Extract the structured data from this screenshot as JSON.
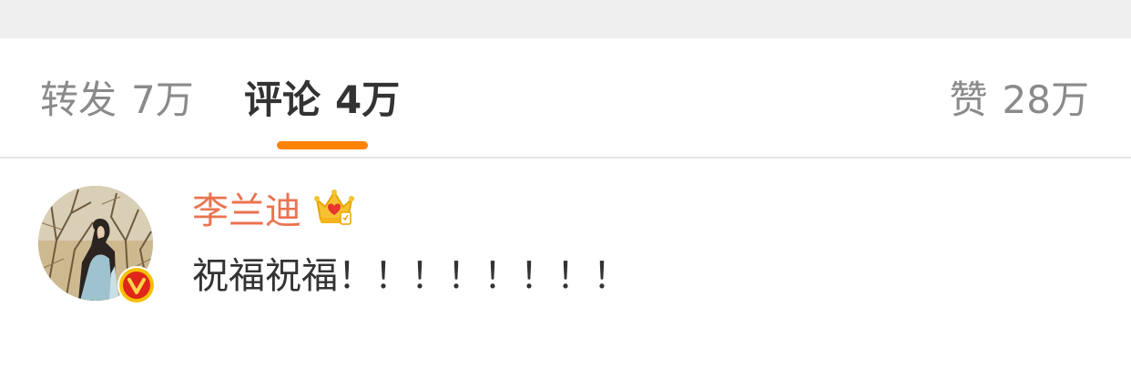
{
  "tabs": {
    "repost": {
      "label": "转发",
      "count": "7万"
    },
    "comment": {
      "label": "评论",
      "count": "4万"
    },
    "like": {
      "label": "赞",
      "count": "28万"
    }
  },
  "colors": {
    "accent": "#ff8200",
    "username": "#eb7350",
    "active_tab": "#333333",
    "inactive_tab": "#8a8a8a",
    "top_strip": "#efefef"
  },
  "comment": {
    "username": "李兰迪",
    "text": "祝福祝福！！！！！！！！",
    "user_badge_icon": "crown-vip-icon",
    "avatar_badge_icon": "verified-v-icon"
  }
}
